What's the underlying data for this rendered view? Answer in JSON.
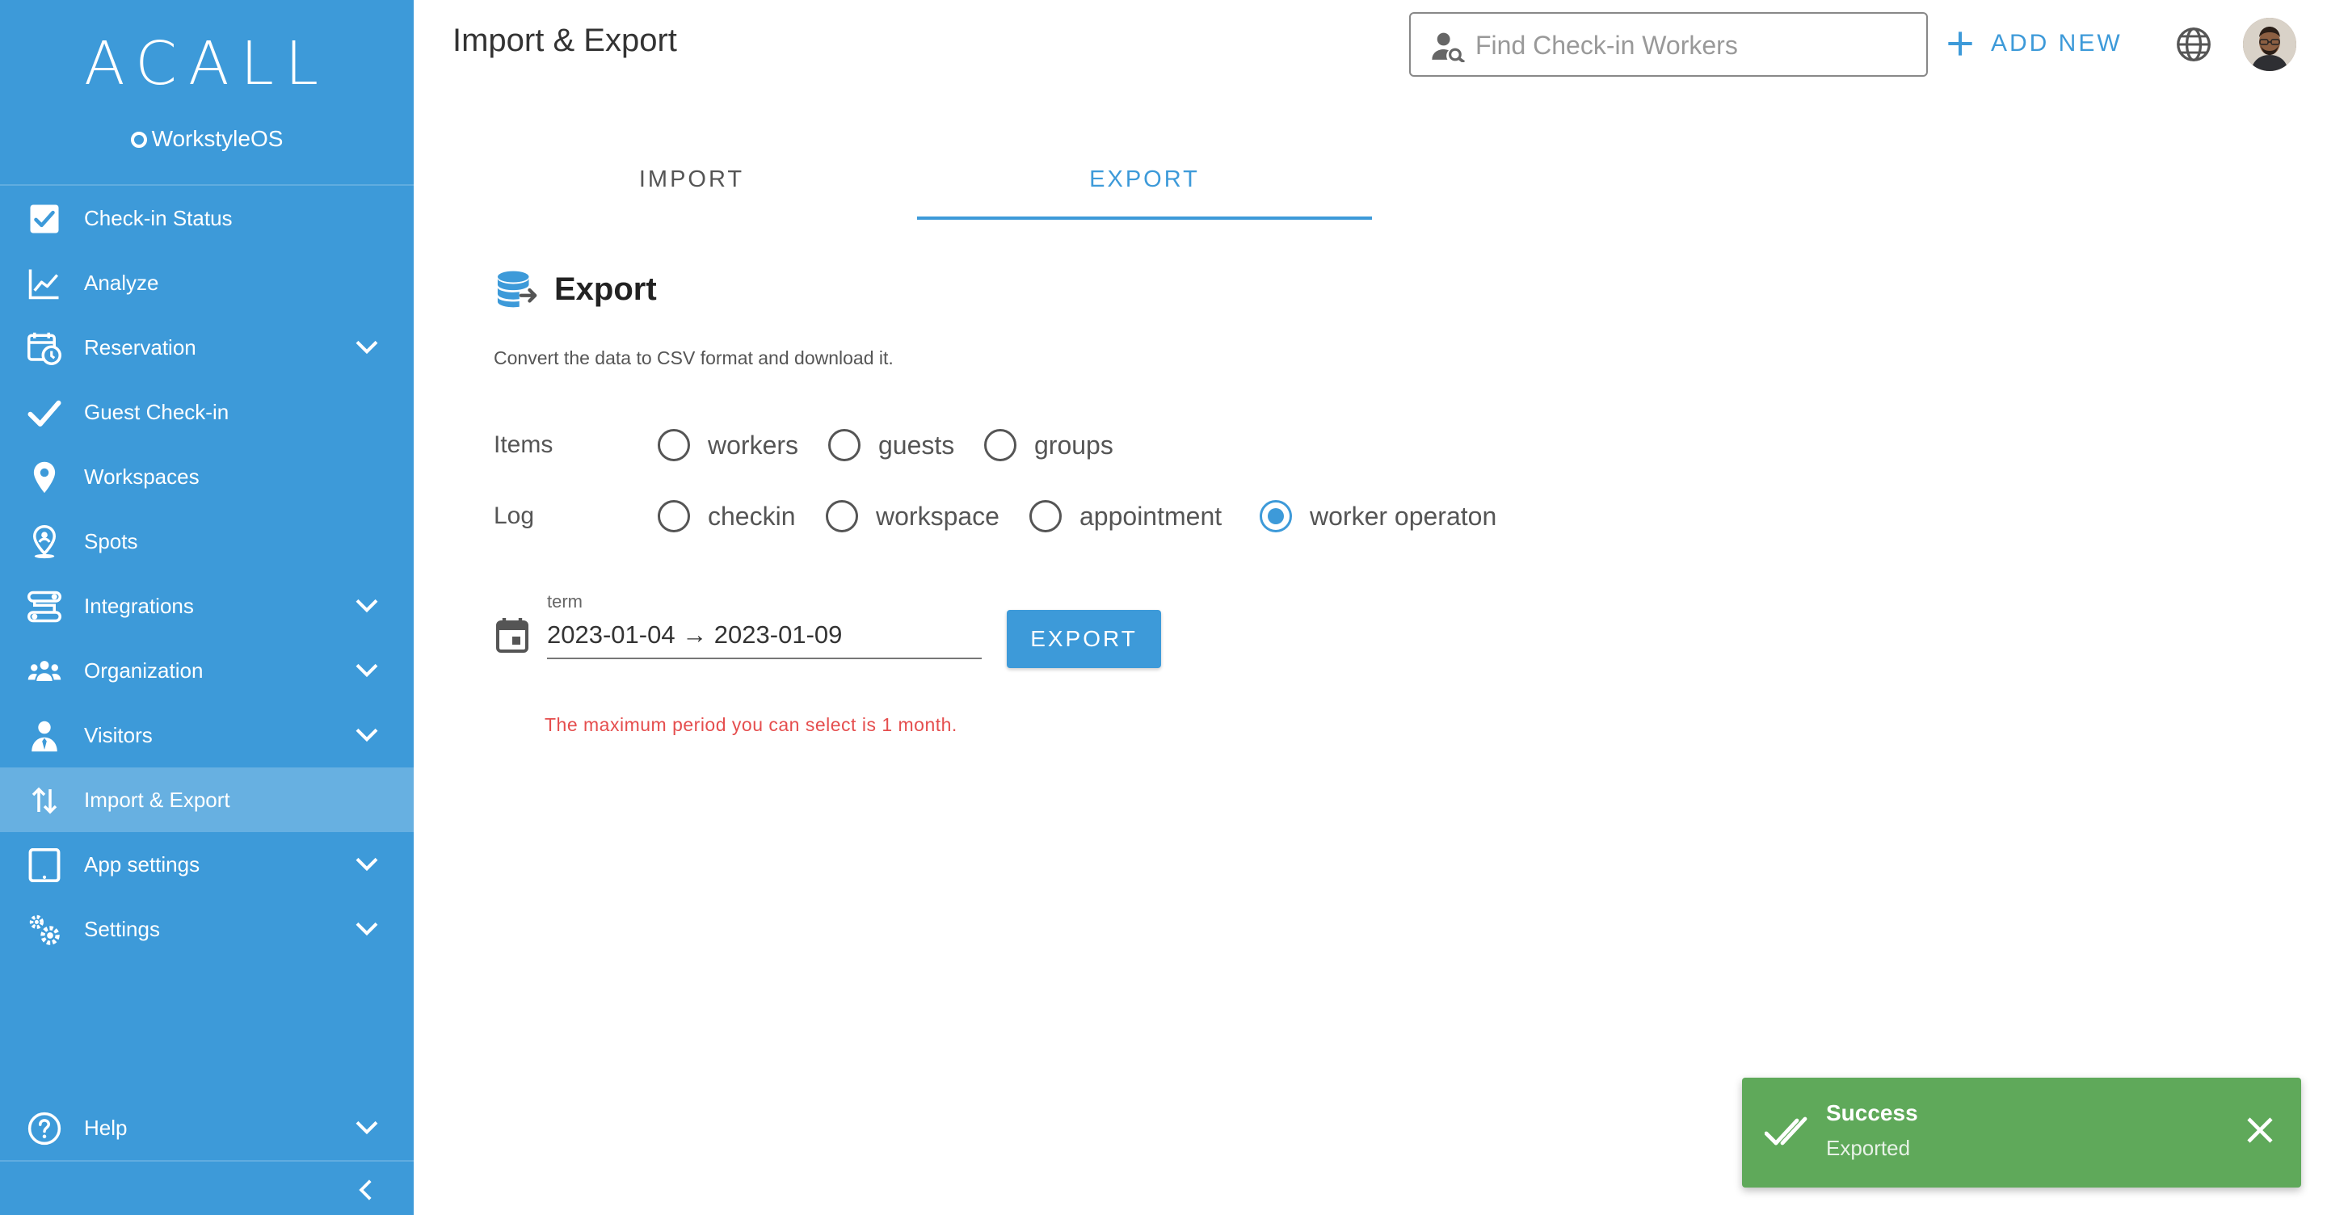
{
  "sidebar": {
    "logo": "ACALL",
    "product_bold": "Workstyle",
    "product_light": "OS",
    "items": [
      {
        "label": "Check-in Status",
        "icon": "checkbox-icon",
        "expandable": false
      },
      {
        "label": "Analyze",
        "icon": "line-chart-icon",
        "expandable": false
      },
      {
        "label": "Reservation",
        "icon": "calendar-clock-icon",
        "expandable": true
      },
      {
        "label": "Guest Check-in",
        "icon": "checkmark-icon",
        "expandable": false
      },
      {
        "label": "Workspaces",
        "icon": "location-pin-icon",
        "expandable": false
      },
      {
        "label": "Spots",
        "icon": "person-pin-icon",
        "expandable": false
      },
      {
        "label": "Integrations",
        "icon": "integrations-icon",
        "expandable": true
      },
      {
        "label": "Organization",
        "icon": "people-icon",
        "expandable": true
      },
      {
        "label": "Visitors",
        "icon": "visitor-icon",
        "expandable": true
      },
      {
        "label": "Import & Export",
        "icon": "import-export-icon",
        "expandable": false,
        "active": true
      },
      {
        "label": "App settings",
        "icon": "tablet-icon",
        "expandable": true
      },
      {
        "label": "Settings",
        "icon": "gears-icon",
        "expandable": true
      }
    ],
    "help_label": "Help"
  },
  "header": {
    "title": "Import & Export",
    "search_placeholder": "Find Check-in Workers",
    "add_new_label": "ADD NEW"
  },
  "tabs": [
    {
      "label": "IMPORT",
      "active": false
    },
    {
      "label": "EXPORT",
      "active": true
    }
  ],
  "export": {
    "title": "Export",
    "description": "Convert the data to CSV format and download it.",
    "items_label": "Items",
    "items_options": [
      "workers",
      "guests",
      "groups"
    ],
    "log_label": "Log",
    "log_options": [
      "checkin",
      "workspace",
      "appointment",
      "worker operaton"
    ],
    "log_selected": "worker operaton",
    "term_label": "term",
    "term_value": "2023-01-04 → 2023-01-09",
    "button_label": "EXPORT",
    "error": "The maximum period you can select is 1 month."
  },
  "toast": {
    "title": "Success",
    "message": "Exported"
  },
  "colors": {
    "primary": "#3d9ad9",
    "success": "#5fa95a",
    "error": "#e54e4e"
  }
}
